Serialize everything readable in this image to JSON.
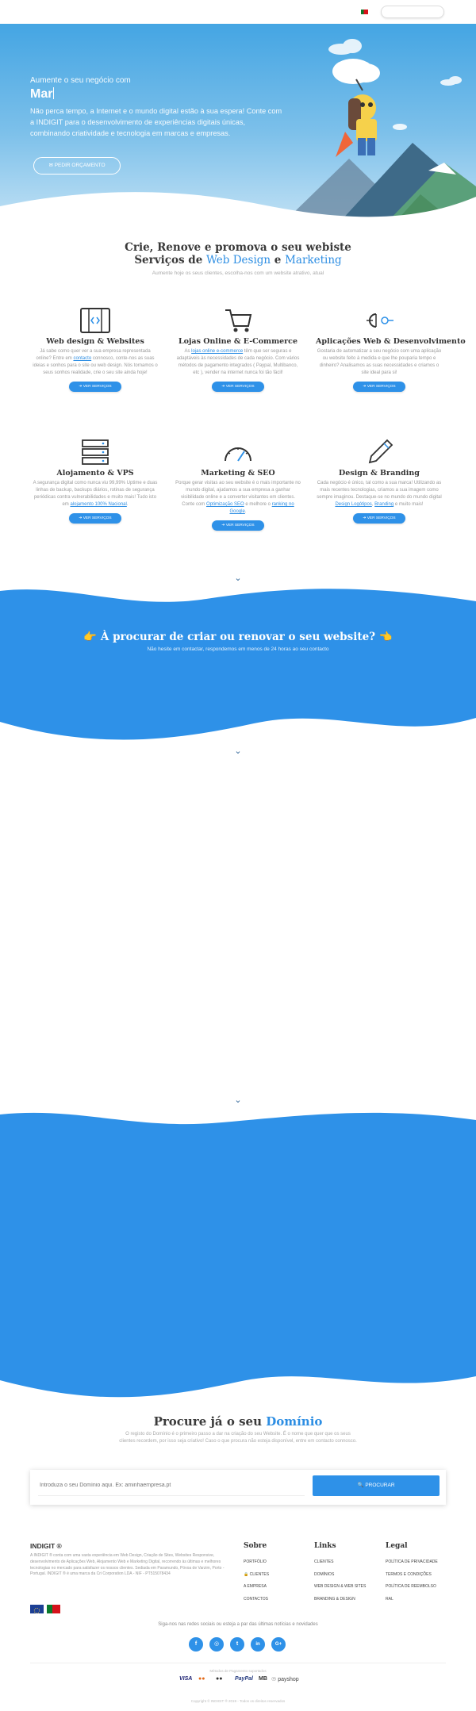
{
  "header": {
    "flag_icon": "portugal-flag-icon",
    "search_placeholder": ""
  },
  "hero": {
    "subtitle": "Aumente o seu negócio com",
    "title_typed": "Mar",
    "text": "Não perca tempo, a Internet e o mundo digital estão à sua espera! Conte com a INDIGIT para o desenvolvimento de experiências digitais únicas, combinando criatividade e tecnologia em marcas e empresas.",
    "button_label": "✉ PEDIR ORÇAMENTO"
  },
  "services": {
    "title_line1": "Crie, Renove e promova o seu webiste",
    "title_line2_a": "Serviços de ",
    "title_line2_b": "Web Design",
    "title_line2_c": " e ",
    "title_line2_d": "Marketing",
    "subtitle": "Aumente hoje os seus clientes, escolha-nos com um website atrativo, atual",
    "button_label": "➜ VER SERVIÇOS",
    "cards": [
      {
        "icon": "code-window-icon",
        "title": "Web design & Websites",
        "text_a": "Já sabe como quer ver a sua empresa representada online? Entre em ",
        "link": "contacto",
        "text_b": " connosco, conte-nos as suas ideias e sonhos para o site ou web design. Nós tornamos o seus sonhos realidade, crie o seu site ainda hoje!"
      },
      {
        "icon": "shopping-cart-icon",
        "title": "Lojas Online & E-Commerce",
        "text_a": "As ",
        "link": "lojas online e-commerce",
        "text_b": " têm que ser seguras e adaptáveis às necessidades de cada negócio. Com vários métodos de pagamento integrados ( Paypal, Multibanco, etc ), vender na internet nunca foi tão fácil!"
      },
      {
        "icon": "plug-connector-icon",
        "title": "Aplicações Web & Desenvolvimento",
        "text_a": "Gostaria de automatizar a seu negócio com uma aplicação ou website feito à medida e que lhe pouparia tempo e dinheiro? Analisamos as suas necessidades e criamos o site ideal para si!",
        "link": "",
        "text_b": ""
      },
      {
        "icon": "server-rack-icon",
        "title": "Alojamento & VPS",
        "text_a": "A segurança digital como nunca viu 99,99% Uptime e duas linhas de backup, backups diários, rotinas de segurança periódicas contra vulnerabilidades e muito mais! Tudo isto em ",
        "link": "alojamento 100% Nacional",
        "text_b": "."
      },
      {
        "icon": "speedometer-icon",
        "title": "Marketing & SEO",
        "text_a": "Porque gerar visitas ao seu website é o mais importante no mundo digital, ajudamos a sua empresa a ganhar visibilidade online e a converter visitantes em clientes. Conte com ",
        "link": "Optimização SEO",
        "text_b": " e melhore o ",
        "link2": "ranking no Google",
        "text_c": "."
      },
      {
        "icon": "pencil-icon",
        "title": "Design & Branding",
        "text_a": "Cada negócio é único, tal como a sua marca! Utilizando as mais recentes tecnologias, criamos a sua imagem como sempre imaginou. Destaque-se no mundo do mundo digital ",
        "link": "Design Logótipos",
        "text_b": ", ",
        "link2": "Branding",
        "text_c": " e muito mais!"
      }
    ]
  },
  "cta_band": {
    "emoji_left": "👉",
    "title": "À procurar de criar ou renovar o seu website?",
    "emoji_right": "👈",
    "subtitle": "Não hesite em contactar, respondemos em menos de 24 horas ao seu contacto"
  },
  "domain": {
    "title_a": "Procure já o seu ",
    "title_b": "Domínio",
    "subtitle": "O registo do Domínio é o primeiro passo a dar na criação do seu Website. É o nome que quer que os seus clientes recordem, por isso seja criativo! Caso o que procura não esteja disponível, entre em contacto connosco.",
    "placeholder": "Introduza o seu Domínio aqui. Ex: aminhaempresa.pt",
    "button_label": "🔍 PROCURAR"
  },
  "footer": {
    "brand": "INDIGIT ®",
    "description": "A INDIGIT ® conta com uma vasta experiência em Web Design, Criação de Sites, Websites Responsive, desenvolvimento de Aplicações Web, Alojamento Web e Marketing Digital, recorrendo às últimas e melhores tecnologias no mercado para satisfazer os nossos clientes. Sediada em Paramundo, Póvoa de Varzim, Porto - Portugal. INDIGIT ® é uma marca da Cri Corporation LDA - NIF - PT515078434",
    "flags": [
      "eu-flag-icon",
      "portugal-flag-icon"
    ],
    "columns": [
      {
        "title": "Sobre",
        "items": [
          "PORTFÓLIO",
          "🔒 CLIENTES",
          "A EMPRESA",
          "CONTACTOS"
        ]
      },
      {
        "title": "Links",
        "items": [
          "CLIENTES",
          "DOMÍNIOS",
          "WEB DESIGN & WEB SITES",
          "BRANDING & DESIGN"
        ]
      },
      {
        "title": "Legal",
        "items": [
          "POLÍTICA DE PRIVACIDADE",
          "TERMOS E CONDIÇÕES",
          "POLÍTICA DE REEMBOLSO",
          "RAL"
        ]
      }
    ],
    "social_text": "Siga-nos nas redes sociais ou esteja a par das últimas notícias e novidades",
    "social": [
      {
        "icon": "facebook-icon",
        "glyph": "f"
      },
      {
        "icon": "instagram-icon",
        "glyph": "◎"
      },
      {
        "icon": "twitter-icon",
        "glyph": "t"
      },
      {
        "icon": "linkedin-icon",
        "glyph": "in"
      },
      {
        "icon": "google-plus-icon",
        "glyph": "G+"
      }
    ],
    "payment_label": "Métodos de Pagamento suportados",
    "payments": [
      "VISA",
      "●●",
      "●●",
      "PayPal",
      "MB",
      "☉ payshop"
    ],
    "copyright": "Copyright © INDIGIT ® 2019 - Todos os direitos reservados"
  },
  "colors": {
    "accent": "#2e91e8",
    "hero_top": "#44a5e3",
    "band": "#2e91e8"
  }
}
